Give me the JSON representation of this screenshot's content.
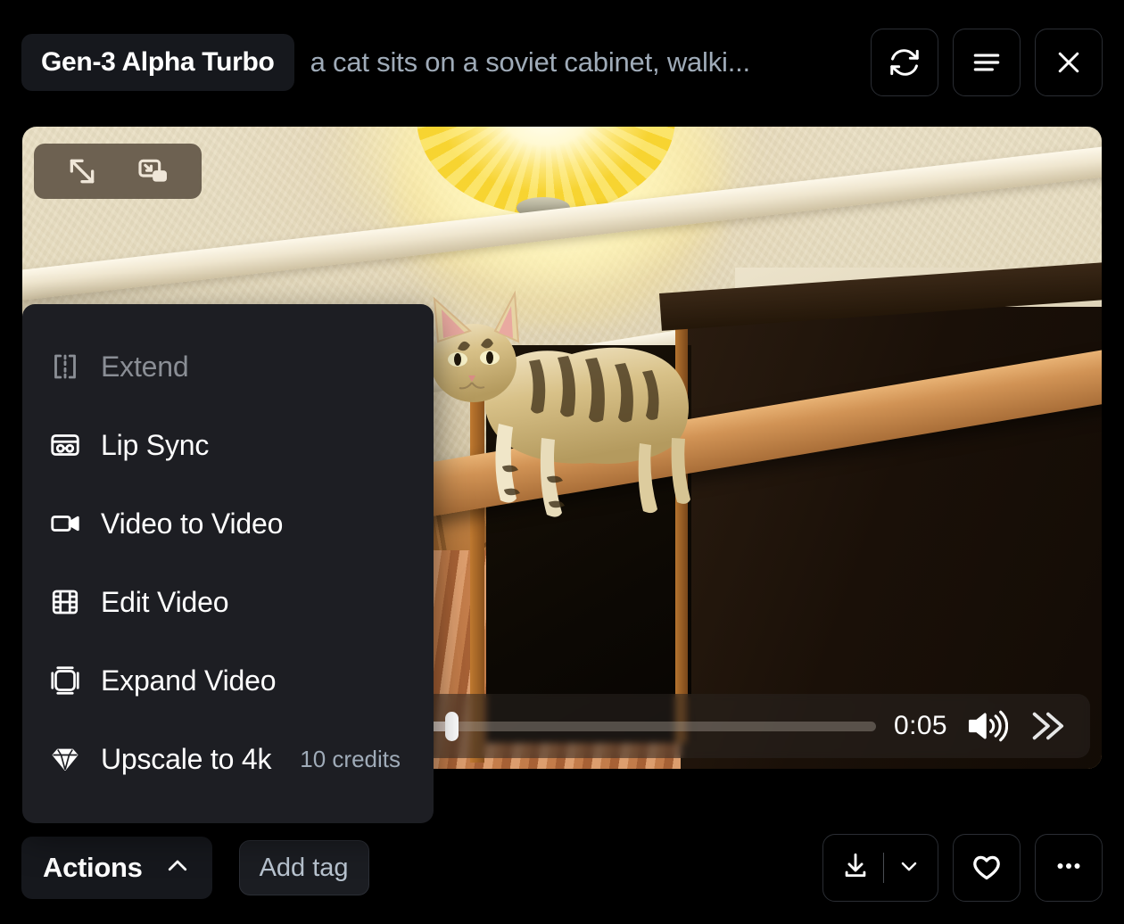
{
  "header": {
    "model_badge": "Gen-3 Alpha Turbo",
    "prompt": "a cat sits on a soviet cabinet, walki...",
    "buttons": [
      {
        "name": "regenerate",
        "icon": "refresh-icon"
      },
      {
        "name": "details",
        "icon": "list-lines-icon"
      },
      {
        "name": "close",
        "icon": "close-icon"
      }
    ]
  },
  "video": {
    "overlay_buttons": [
      {
        "name": "fullscreen",
        "icon": "expand-diagonal-icon"
      },
      {
        "name": "picture-in-picture",
        "icon": "picture-in-picture-icon"
      }
    ],
    "player": {
      "time": "0:05",
      "progress_percent": 49,
      "volume_icon": "speaker-on-icon",
      "speed_icon": "fast-forward-icon"
    }
  },
  "actions_menu": {
    "items": [
      {
        "label": "Extend",
        "icon": "extend-icon",
        "disabled": true,
        "credits": ""
      },
      {
        "label": "Lip Sync",
        "icon": "lip-sync-icon",
        "disabled": false,
        "credits": ""
      },
      {
        "label": "Video to Video",
        "icon": "video-camera-icon",
        "disabled": false,
        "credits": ""
      },
      {
        "label": "Edit Video",
        "icon": "film-strip-icon",
        "disabled": false,
        "credits": ""
      },
      {
        "label": "Expand Video",
        "icon": "expand-frame-icon",
        "disabled": false,
        "credits": ""
      },
      {
        "label": "Upscale to 4k",
        "icon": "diamond-icon",
        "disabled": false,
        "credits": "10 credits"
      }
    ]
  },
  "footer": {
    "actions_label": "Actions",
    "actions_chevron": "chevron-up-icon",
    "add_tag_label": "Add tag",
    "right_buttons": [
      {
        "name": "download",
        "icon": "download-icon"
      },
      {
        "name": "download-options",
        "icon": "chevron-down-icon"
      },
      {
        "name": "favorite",
        "icon": "heart-icon"
      },
      {
        "name": "more-options",
        "icon": "ellipsis-icon"
      }
    ]
  },
  "colors": {
    "background": "#000000",
    "panel": "#1d1e23",
    "badge": "#16181d",
    "muted_text": "#9fabb8",
    "disabled_text": "#8a8e95",
    "border": "#2a2d33"
  }
}
